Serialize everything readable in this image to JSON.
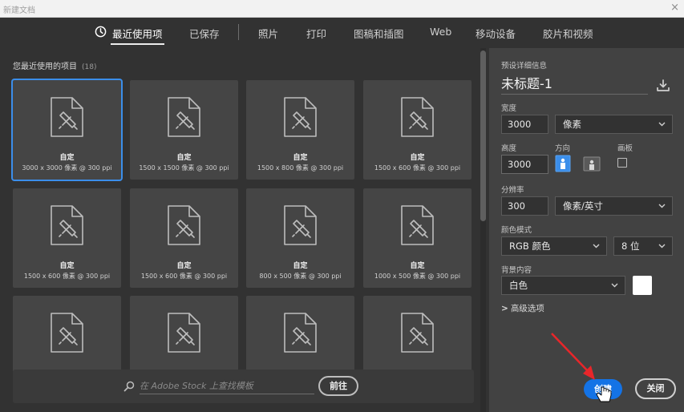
{
  "window": {
    "title": "新建文档",
    "close_glyph": "×"
  },
  "tabs": [
    {
      "label": "最近使用项",
      "active": true,
      "icon": "clock-icon"
    },
    {
      "label": "已保存"
    },
    {
      "label": "照片"
    },
    {
      "label": "打印"
    },
    {
      "label": "图稿和插图"
    },
    {
      "label": "Web"
    },
    {
      "label": "移动设备"
    },
    {
      "label": "胶片和视频"
    }
  ],
  "recent": {
    "title": "您最近使用的项目",
    "count": "(18)",
    "items": [
      {
        "name": "自定",
        "dims": "3000 x 3000 像素 @ 300 ppi",
        "selected": true
      },
      {
        "name": "自定",
        "dims": "1500 x 1500 像素 @ 300 ppi"
      },
      {
        "name": "自定",
        "dims": "1500 x 800 像素 @ 300 ppi"
      },
      {
        "name": "自定",
        "dims": "1500 x 600 像素 @ 300 ppi"
      },
      {
        "name": "自定",
        "dims": "1500 x 600 像素 @ 300 ppi"
      },
      {
        "name": "自定",
        "dims": "1500 x 600 像素 @ 300 ppi"
      },
      {
        "name": "自定",
        "dims": "800 x 500 像素 @ 300 ppi"
      },
      {
        "name": "自定",
        "dims": "1000 x 500 像素 @ 300 ppi"
      },
      {
        "name": "",
        "dims": ""
      },
      {
        "name": "",
        "dims": ""
      },
      {
        "name": "",
        "dims": ""
      },
      {
        "name": "",
        "dims": ""
      }
    ]
  },
  "search": {
    "placeholder": "在 Adobe Stock 上查找模板",
    "go_label": "前往"
  },
  "preset": {
    "section_title": "预设详细信息",
    "doc_name": "未标题-1",
    "width_label": "宽度",
    "width_value": "3000",
    "width_unit": "像素",
    "height_label": "高度",
    "height_value": "3000",
    "orientation_label": "方向",
    "artboard_label": "画板",
    "resolution_label": "分辨率",
    "resolution_value": "300",
    "resolution_unit": "像素/英寸",
    "color_mode_label": "颜色模式",
    "color_mode_value": "RGB 颜色",
    "bit_depth_value": "8 位",
    "background_label": "背景内容",
    "background_value": "白色",
    "background_swatch": "#ffffff",
    "advanced_label": "高级选项"
  },
  "buttons": {
    "create_label": "创建",
    "close_label": "关闭"
  },
  "colors": {
    "accent": "#1473e6",
    "selection": "#3b8eea",
    "annotation_arrow": "#e8262a"
  }
}
